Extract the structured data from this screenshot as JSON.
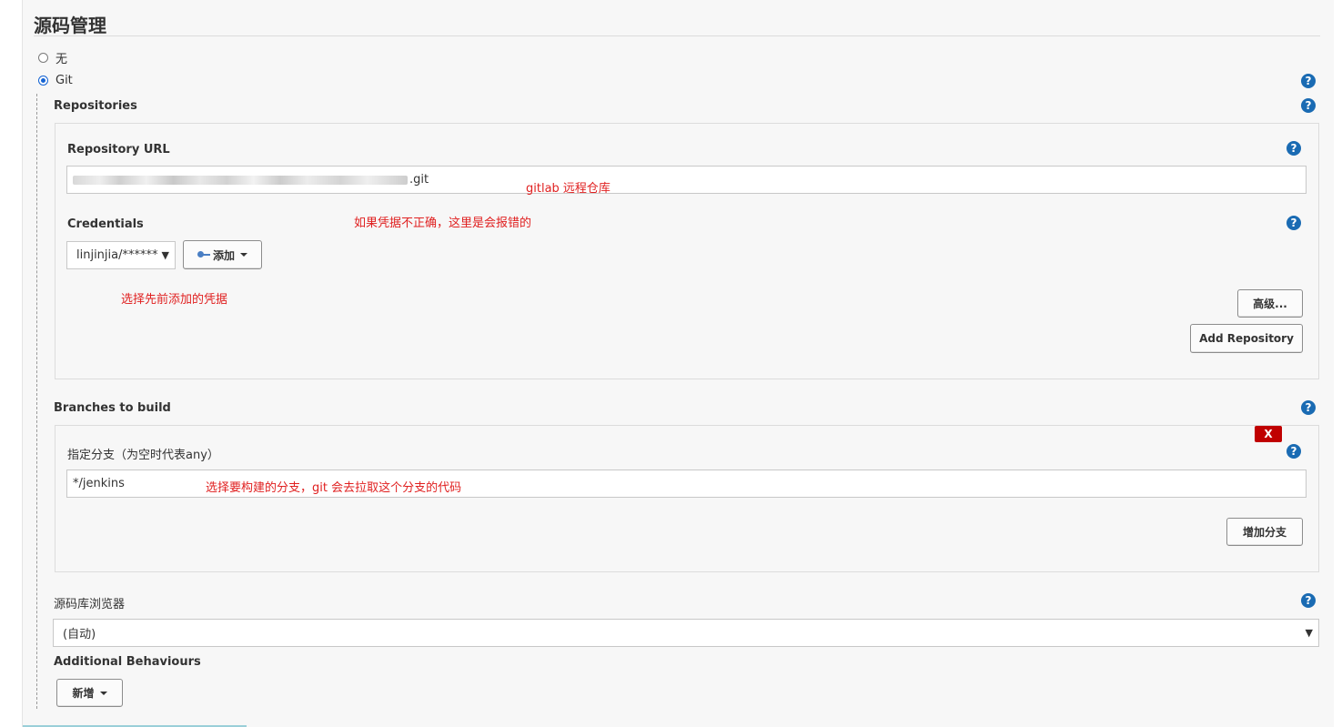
{
  "section": {
    "title": "源码管理"
  },
  "scm_options": [
    {
      "label": "无",
      "checked": false
    },
    {
      "label": "Git",
      "checked": true
    }
  ],
  "help_icon": "?",
  "repositories": {
    "label": "Repositories",
    "url_label": "Repository URL",
    "url_suffix": ".git",
    "url_note": "gitlab 远程仓库",
    "credentials_label": "Credentials",
    "credentials_note": "如果凭据不正确，这里是会报错的",
    "credentials_value": "linjinjia/******",
    "add_label": "添加",
    "select_note": "选择先前添加的凭据",
    "advanced_label": "高级...",
    "add_repo_label": "Add Repository"
  },
  "branches": {
    "label": "Branches to build",
    "delete_label": "X",
    "spec_label": "指定分支（为空时代表any）",
    "spec_value": "*/jenkins",
    "spec_note": "选择要构建的分支，git 会去拉取这个分支的代码",
    "add_branch_label": "增加分支"
  },
  "browser": {
    "label": "源码库浏览器",
    "value": "(自动)"
  },
  "behaviours": {
    "label": "Additional Behaviours",
    "add_label": "新增"
  },
  "icons": {
    "help": "help-icon",
    "key": "key-icon",
    "chevron": "chevron-down-icon",
    "caret": "caret-down-icon"
  },
  "colors": {
    "help_blue": "#1a6bb3",
    "note_red": "#e02020",
    "delete_red": "#c00000",
    "panel_bg": "#f7f7f7"
  }
}
